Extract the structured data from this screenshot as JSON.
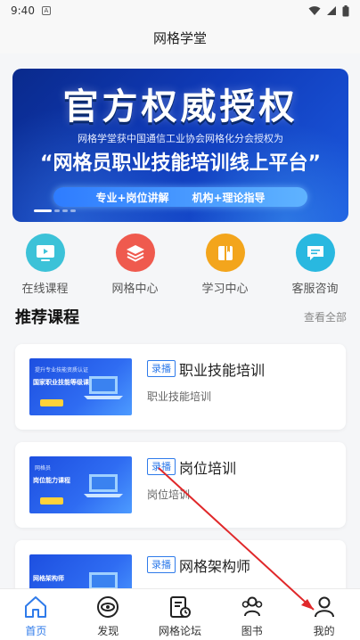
{
  "status_bar": {
    "time": "9:40",
    "badge": "A"
  },
  "title_bar": {
    "title": "网格学堂"
  },
  "banner": {
    "title": "官方权威授权",
    "subtitle": "网格学堂获中国通信工业协会网格化分会授权为",
    "headline": "“网格员职业技能培训线上平台”",
    "pill_left": "专业+岗位讲解",
    "pill_right": "机构+理论指导",
    "slide_count": 4,
    "active_slide": 1
  },
  "quick_menu": [
    {
      "label": "在线课程",
      "icon": "play-screen-icon",
      "color": "#3cc2d8"
    },
    {
      "label": "网格中心",
      "icon": "layers-icon",
      "color": "#ef5a4e"
    },
    {
      "label": "学习中心",
      "icon": "book-icon",
      "color": "#f3a51c"
    },
    {
      "label": "客服咨询",
      "icon": "chat-icon",
      "color": "#29b8e0"
    }
  ],
  "recommend": {
    "title": "推荐课程",
    "more": "查看全部",
    "courses": [
      {
        "tag": "录播",
        "name": "职业技能培训",
        "desc": "职业技能培训",
        "thumb_line1": "提升专业技能资质认证",
        "thumb_line2": "国家职业技能等级课程"
      },
      {
        "tag": "录播",
        "name": "岗位培训",
        "desc": "岗位培训",
        "thumb_line1": "网格员",
        "thumb_line2": "岗位能力课程"
      },
      {
        "tag": "录播",
        "name": "网格架构师",
        "desc": "",
        "thumb_line1": "",
        "thumb_line2": "网格架构师"
      }
    ]
  },
  "bottom_nav": [
    {
      "label": "首页",
      "icon": "home-icon",
      "active": true
    },
    {
      "label": "发现",
      "icon": "eye-icon",
      "active": false
    },
    {
      "label": "网格论坛",
      "icon": "forum-icon",
      "active": false
    },
    {
      "label": "图书",
      "icon": "users-icon",
      "active": false
    },
    {
      "label": "我的",
      "icon": "profile-icon",
      "active": false
    }
  ],
  "colors": {
    "accent": "#2f7bea",
    "annotation": "#e0282a"
  }
}
